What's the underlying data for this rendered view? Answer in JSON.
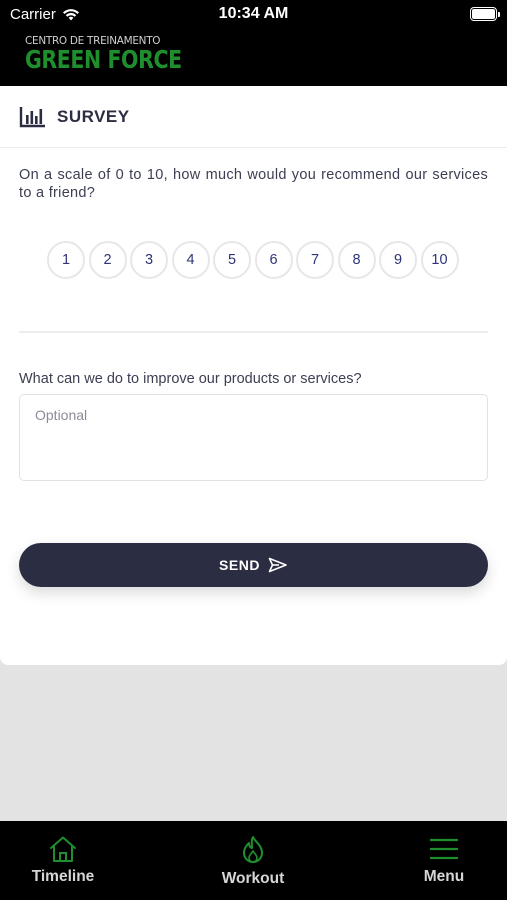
{
  "status_bar": {
    "carrier": "Carrier",
    "time": "10:34 AM"
  },
  "header": {
    "logo_top": "CENTRO DE TREINAMENTO",
    "logo_main": "GREEN FORCE"
  },
  "survey": {
    "title": "SURVEY",
    "question1": "On a scale of 0 to 10, how much would you recommend our services to a friend?",
    "scale": [
      "1",
      "2",
      "3",
      "4",
      "5",
      "6",
      "7",
      "8",
      "9",
      "10"
    ],
    "question2": "What can we do to improve our products or services?",
    "textarea_placeholder": "Optional",
    "send_label": "SEND"
  },
  "tabs": [
    {
      "label": "Timeline",
      "icon": "home-icon"
    },
    {
      "label": "Workout",
      "icon": "flame-icon"
    },
    {
      "label": "Menu",
      "icon": "hamburger-icon"
    }
  ],
  "colors": {
    "brand_green": "#1f8f2e",
    "primary_dark": "#2b2d42",
    "scale_text": "#2d3576"
  }
}
